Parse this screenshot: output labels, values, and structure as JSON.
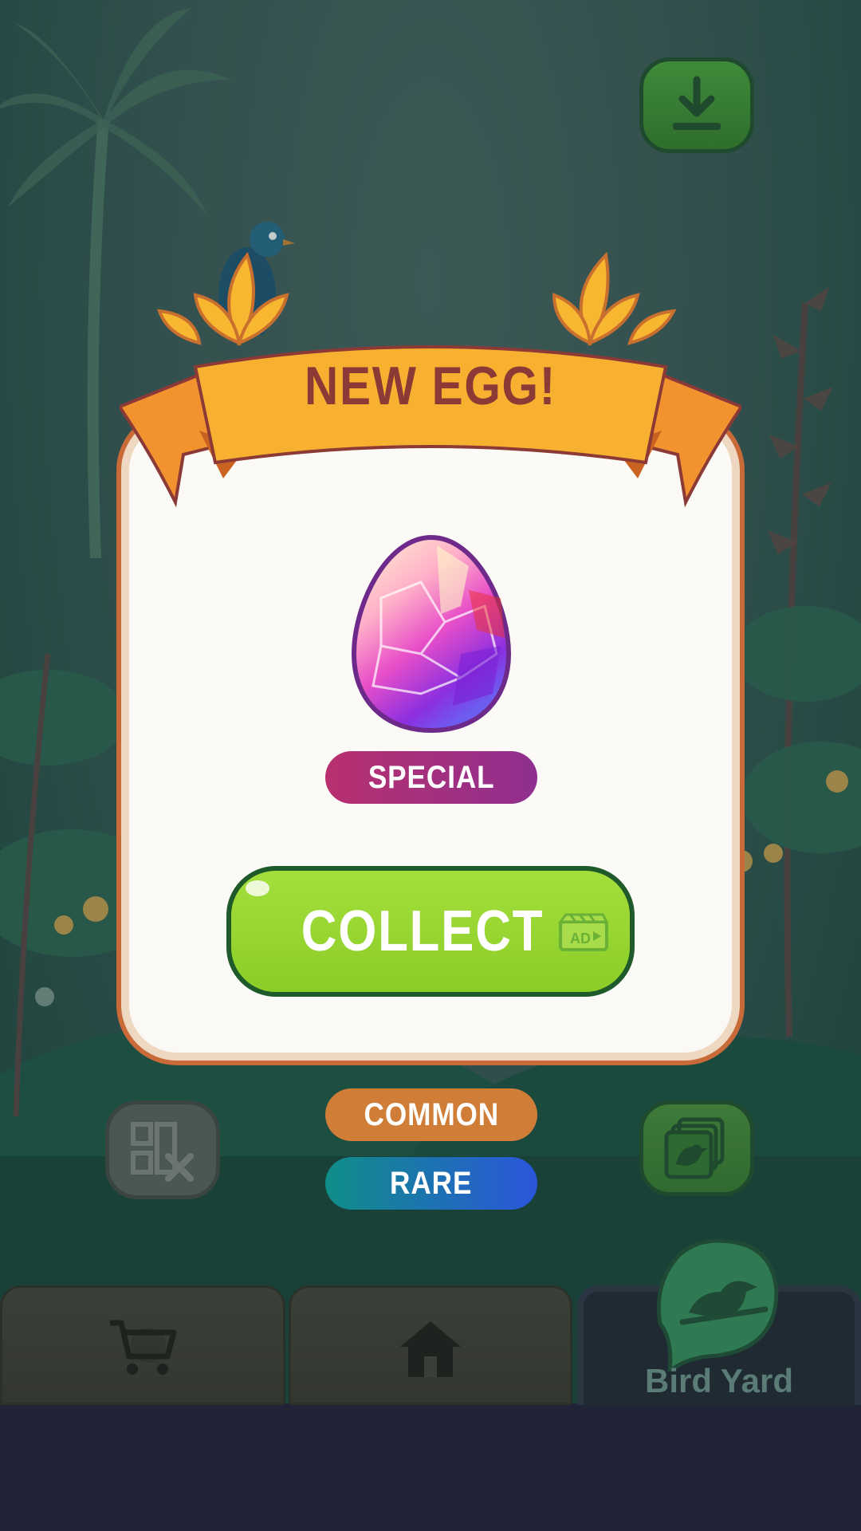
{
  "popup": {
    "title": "NEW EGG!",
    "egg_type": "SPECIAL",
    "collect_label": "COLLECT",
    "ad_badge": "AD"
  },
  "egg_types": [
    "COMMON",
    "RARE"
  ],
  "buttons": {
    "download_icon": "download-icon",
    "album_icon": "bird-album-icon",
    "no_ads_icon": "no-ads-icon"
  },
  "nav": {
    "tabs": [
      {
        "name": "shop",
        "icon": "cart-icon",
        "label": ""
      },
      {
        "name": "home",
        "icon": "home-icon",
        "label": ""
      },
      {
        "name": "bird-yard",
        "icon": "bird-icon",
        "label": "Bird Yard"
      }
    ],
    "active": "bird-yard"
  },
  "colors": {
    "accent_orange": "#f7a531",
    "collect_green": "#9bd532",
    "special_magenta": "#a5307a",
    "common_orange": "#cf7d37",
    "rare_gradient_start": "#0f8e88",
    "rare_gradient_end": "#2b56db"
  }
}
